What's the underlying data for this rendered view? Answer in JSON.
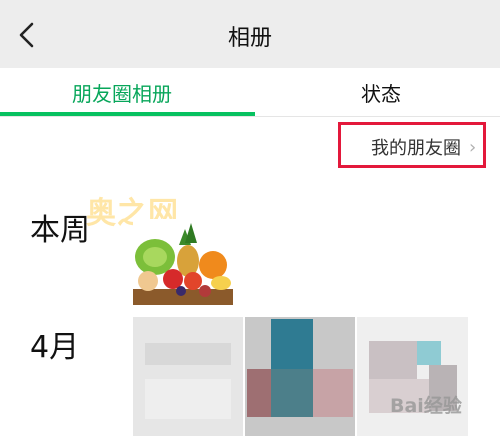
{
  "header": {
    "title": "相册",
    "back_icon": "chevron-left-icon"
  },
  "tabs": [
    {
      "label": "朋友圈相册",
      "active": true
    },
    {
      "label": "状态",
      "active": false
    }
  ],
  "accent_color": "#07c160",
  "moments_link": {
    "label": "我的朋友圈",
    "icon": "chevron-right-icon"
  },
  "sections": [
    {
      "label": "本周"
    },
    {
      "label": "4月"
    }
  ],
  "watermark": {
    "site_logo": "奥之网",
    "baidu": "Bai经验"
  }
}
